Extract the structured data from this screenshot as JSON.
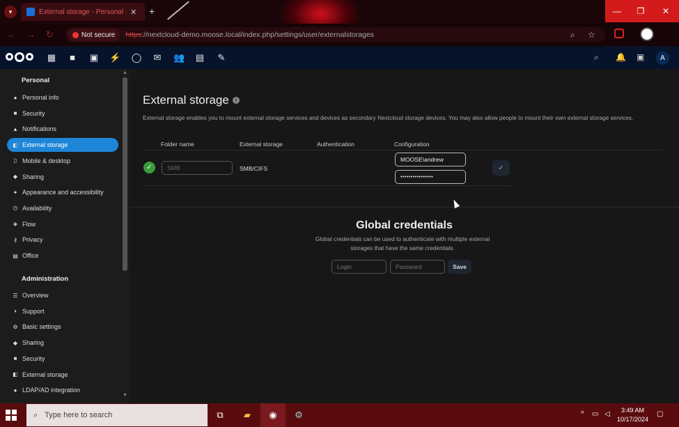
{
  "browser": {
    "tab_title": "External storage - Personal settings",
    "new_tab_symbol": "+",
    "security_label": "Not secure",
    "url_scheme": "https",
    "url_rest": "://nextcloud-demo.moose.local/index.php/settings/user/externalstorages"
  },
  "sidebar": {
    "personal_heading": "Personal",
    "personal_items": [
      {
        "label": "Personal info",
        "icon": "person-icon"
      },
      {
        "label": "Security",
        "icon": "lock-icon"
      },
      {
        "label": "Notifications",
        "icon": "bell-icon"
      },
      {
        "label": "External storage",
        "icon": "external-storage-icon",
        "active": true
      },
      {
        "label": "Mobile & desktop",
        "icon": "phone-icon"
      },
      {
        "label": "Sharing",
        "icon": "share-icon"
      },
      {
        "label": "Appearance and accessibility",
        "icon": "accessibility-icon"
      },
      {
        "label": "Availability",
        "icon": "clock-icon"
      },
      {
        "label": "Flow",
        "icon": "flow-icon"
      },
      {
        "label": "Privacy",
        "icon": "key-icon"
      },
      {
        "label": "Office",
        "icon": "document-icon"
      }
    ],
    "admin_heading": "Administration",
    "admin_items": [
      {
        "label": "Overview",
        "icon": "list-icon"
      },
      {
        "label": "Support",
        "icon": "chat-icon"
      },
      {
        "label": "Basic settings",
        "icon": "gear-icon"
      },
      {
        "label": "Sharing",
        "icon": "share-icon"
      },
      {
        "label": "Security",
        "icon": "lock-icon"
      },
      {
        "label": "External storage",
        "icon": "external-storage-icon"
      },
      {
        "label": "LDAP/AD integration",
        "icon": "person-icon"
      }
    ]
  },
  "main": {
    "title": "External storage",
    "description": "External storage enables you to mount external storage services and devices as secondary Nextcloud storage devices. You may also allow people to mount their own external storage services.",
    "table": {
      "headers": [
        "Folder name",
        "External storage",
        "Authentication",
        "Configuration"
      ],
      "row": {
        "folder_placeholder": "SMB",
        "storage_type": "SMB/CIFS",
        "config_user": "MOOSE\\andrew",
        "config_password": "••••••••••••••••"
      }
    },
    "global": {
      "title": "Global credentials",
      "description": "Global credentials can be used to authenticate with multiple external storages that have the same credentials.",
      "login_placeholder": "Login",
      "password_placeholder": "Password",
      "save_label": "Save"
    }
  },
  "taskbar": {
    "search_placeholder": "Type here to search",
    "time": "3:49 AM",
    "date": "10/17/2024"
  }
}
